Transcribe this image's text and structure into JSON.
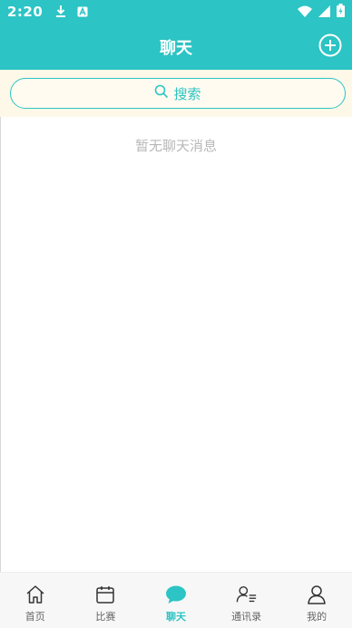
{
  "status_bar": {
    "time": "2:20",
    "icons": [
      "download-icon",
      "notification-a-icon",
      "wifi-icon",
      "signal-icon",
      "battery-icon"
    ]
  },
  "header": {
    "title": "聊天",
    "add_icon": "plus-circle-icon"
  },
  "search": {
    "label": "搜索",
    "icon": "search-icon"
  },
  "main": {
    "empty_message": "暂无聊天消息"
  },
  "tab_bar": {
    "active_color": "#2cc4c4",
    "tabs": [
      {
        "label": "首页",
        "icon": "home-icon",
        "active": false
      },
      {
        "label": "比赛",
        "icon": "calendar-icon",
        "active": false
      },
      {
        "label": "聊天",
        "icon": "chat-bubble-icon",
        "active": true
      },
      {
        "label": "通讯录",
        "icon": "contacts-icon",
        "active": false
      },
      {
        "label": "我的",
        "icon": "profile-icon",
        "active": false
      }
    ]
  },
  "colors": {
    "primary": "#2cc4c4",
    "search_background": "#fdf8e8",
    "empty_text": "#b8b8b8"
  }
}
